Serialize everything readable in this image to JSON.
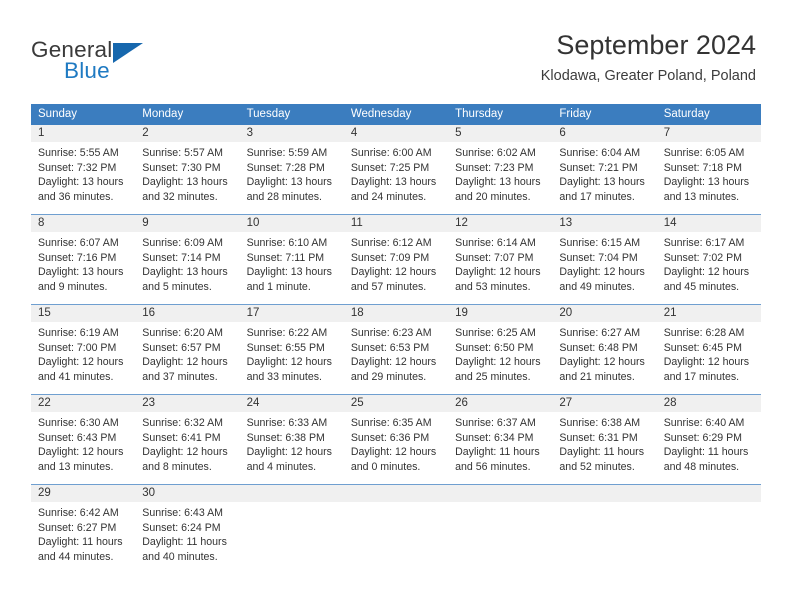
{
  "brand": {
    "name_top": "General",
    "name_bottom": "Blue",
    "triangle_color": "#1667ad",
    "blue_text_color": "#1f7ac2",
    "dark_text_color": "#3a3a3a"
  },
  "header": {
    "title": "September 2024",
    "subtitle": "Klodawa, Greater Poland, Poland"
  },
  "theme": {
    "header_row_bg": "#3b7dbf",
    "header_row_text": "#ffffff",
    "day_number_bg": "#f0f0f0",
    "cell_bg": "#ffffff",
    "week_divider": "#6f9fd0",
    "body_text": "#333333"
  },
  "weekdays": [
    "Sunday",
    "Monday",
    "Tuesday",
    "Wednesday",
    "Thursday",
    "Friday",
    "Saturday"
  ],
  "labels": {
    "sunrise_prefix": "Sunrise:",
    "sunset_prefix": "Sunset:",
    "daylight_prefix": "Daylight:"
  },
  "weeks": [
    {
      "days": [
        {
          "number": "1",
          "lines": [
            "Sunrise: 5:55 AM",
            "Sunset: 7:32 PM",
            "Daylight: 13 hours",
            "and 36 minutes."
          ]
        },
        {
          "number": "2",
          "lines": [
            "Sunrise: 5:57 AM",
            "Sunset: 7:30 PM",
            "Daylight: 13 hours",
            "and 32 minutes."
          ]
        },
        {
          "number": "3",
          "lines": [
            "Sunrise: 5:59 AM",
            "Sunset: 7:28 PM",
            "Daylight: 13 hours",
            "and 28 minutes."
          ]
        },
        {
          "number": "4",
          "lines": [
            "Sunrise: 6:00 AM",
            "Sunset: 7:25 PM",
            "Daylight: 13 hours",
            "and 24 minutes."
          ]
        },
        {
          "number": "5",
          "lines": [
            "Sunrise: 6:02 AM",
            "Sunset: 7:23 PM",
            "Daylight: 13 hours",
            "and 20 minutes."
          ]
        },
        {
          "number": "6",
          "lines": [
            "Sunrise: 6:04 AM",
            "Sunset: 7:21 PM",
            "Daylight: 13 hours",
            "and 17 minutes."
          ]
        },
        {
          "number": "7",
          "lines": [
            "Sunrise: 6:05 AM",
            "Sunset: 7:18 PM",
            "Daylight: 13 hours",
            "and 13 minutes."
          ]
        }
      ]
    },
    {
      "days": [
        {
          "number": "8",
          "lines": [
            "Sunrise: 6:07 AM",
            "Sunset: 7:16 PM",
            "Daylight: 13 hours",
            "and 9 minutes."
          ]
        },
        {
          "number": "9",
          "lines": [
            "Sunrise: 6:09 AM",
            "Sunset: 7:14 PM",
            "Daylight: 13 hours",
            "and 5 minutes."
          ]
        },
        {
          "number": "10",
          "lines": [
            "Sunrise: 6:10 AM",
            "Sunset: 7:11 PM",
            "Daylight: 13 hours",
            "and 1 minute."
          ]
        },
        {
          "number": "11",
          "lines": [
            "Sunrise: 6:12 AM",
            "Sunset: 7:09 PM",
            "Daylight: 12 hours",
            "and 57 minutes."
          ]
        },
        {
          "number": "12",
          "lines": [
            "Sunrise: 6:14 AM",
            "Sunset: 7:07 PM",
            "Daylight: 12 hours",
            "and 53 minutes."
          ]
        },
        {
          "number": "13",
          "lines": [
            "Sunrise: 6:15 AM",
            "Sunset: 7:04 PM",
            "Daylight: 12 hours",
            "and 49 minutes."
          ]
        },
        {
          "number": "14",
          "lines": [
            "Sunrise: 6:17 AM",
            "Sunset: 7:02 PM",
            "Daylight: 12 hours",
            "and 45 minutes."
          ]
        }
      ]
    },
    {
      "days": [
        {
          "number": "15",
          "lines": [
            "Sunrise: 6:19 AM",
            "Sunset: 7:00 PM",
            "Daylight: 12 hours",
            "and 41 minutes."
          ]
        },
        {
          "number": "16",
          "lines": [
            "Sunrise: 6:20 AM",
            "Sunset: 6:57 PM",
            "Daylight: 12 hours",
            "and 37 minutes."
          ]
        },
        {
          "number": "17",
          "lines": [
            "Sunrise: 6:22 AM",
            "Sunset: 6:55 PM",
            "Daylight: 12 hours",
            "and 33 minutes."
          ]
        },
        {
          "number": "18",
          "lines": [
            "Sunrise: 6:23 AM",
            "Sunset: 6:53 PM",
            "Daylight: 12 hours",
            "and 29 minutes."
          ]
        },
        {
          "number": "19",
          "lines": [
            "Sunrise: 6:25 AM",
            "Sunset: 6:50 PM",
            "Daylight: 12 hours",
            "and 25 minutes."
          ]
        },
        {
          "number": "20",
          "lines": [
            "Sunrise: 6:27 AM",
            "Sunset: 6:48 PM",
            "Daylight: 12 hours",
            "and 21 minutes."
          ]
        },
        {
          "number": "21",
          "lines": [
            "Sunrise: 6:28 AM",
            "Sunset: 6:45 PM",
            "Daylight: 12 hours",
            "and 17 minutes."
          ]
        }
      ]
    },
    {
      "days": [
        {
          "number": "22",
          "lines": [
            "Sunrise: 6:30 AM",
            "Sunset: 6:43 PM",
            "Daylight: 12 hours",
            "and 13 minutes."
          ]
        },
        {
          "number": "23",
          "lines": [
            "Sunrise: 6:32 AM",
            "Sunset: 6:41 PM",
            "Daylight: 12 hours",
            "and 8 minutes."
          ]
        },
        {
          "number": "24",
          "lines": [
            "Sunrise: 6:33 AM",
            "Sunset: 6:38 PM",
            "Daylight: 12 hours",
            "and 4 minutes."
          ]
        },
        {
          "number": "25",
          "lines": [
            "Sunrise: 6:35 AM",
            "Sunset: 6:36 PM",
            "Daylight: 12 hours",
            "and 0 minutes."
          ]
        },
        {
          "number": "26",
          "lines": [
            "Sunrise: 6:37 AM",
            "Sunset: 6:34 PM",
            "Daylight: 11 hours",
            "and 56 minutes."
          ]
        },
        {
          "number": "27",
          "lines": [
            "Sunrise: 6:38 AM",
            "Sunset: 6:31 PM",
            "Daylight: 11 hours",
            "and 52 minutes."
          ]
        },
        {
          "number": "28",
          "lines": [
            "Sunrise: 6:40 AM",
            "Sunset: 6:29 PM",
            "Daylight: 11 hours",
            "and 48 minutes."
          ]
        }
      ]
    },
    {
      "days": [
        {
          "number": "29",
          "lines": [
            "Sunrise: 6:42 AM",
            "Sunset: 6:27 PM",
            "Daylight: 11 hours",
            "and 44 minutes."
          ]
        },
        {
          "number": "30",
          "lines": [
            "Sunrise: 6:43 AM",
            "Sunset: 6:24 PM",
            "Daylight: 11 hours",
            "and 40 minutes."
          ]
        },
        {
          "number": "",
          "lines": []
        },
        {
          "number": "",
          "lines": []
        },
        {
          "number": "",
          "lines": []
        },
        {
          "number": "",
          "lines": []
        },
        {
          "number": "",
          "lines": []
        }
      ]
    }
  ]
}
